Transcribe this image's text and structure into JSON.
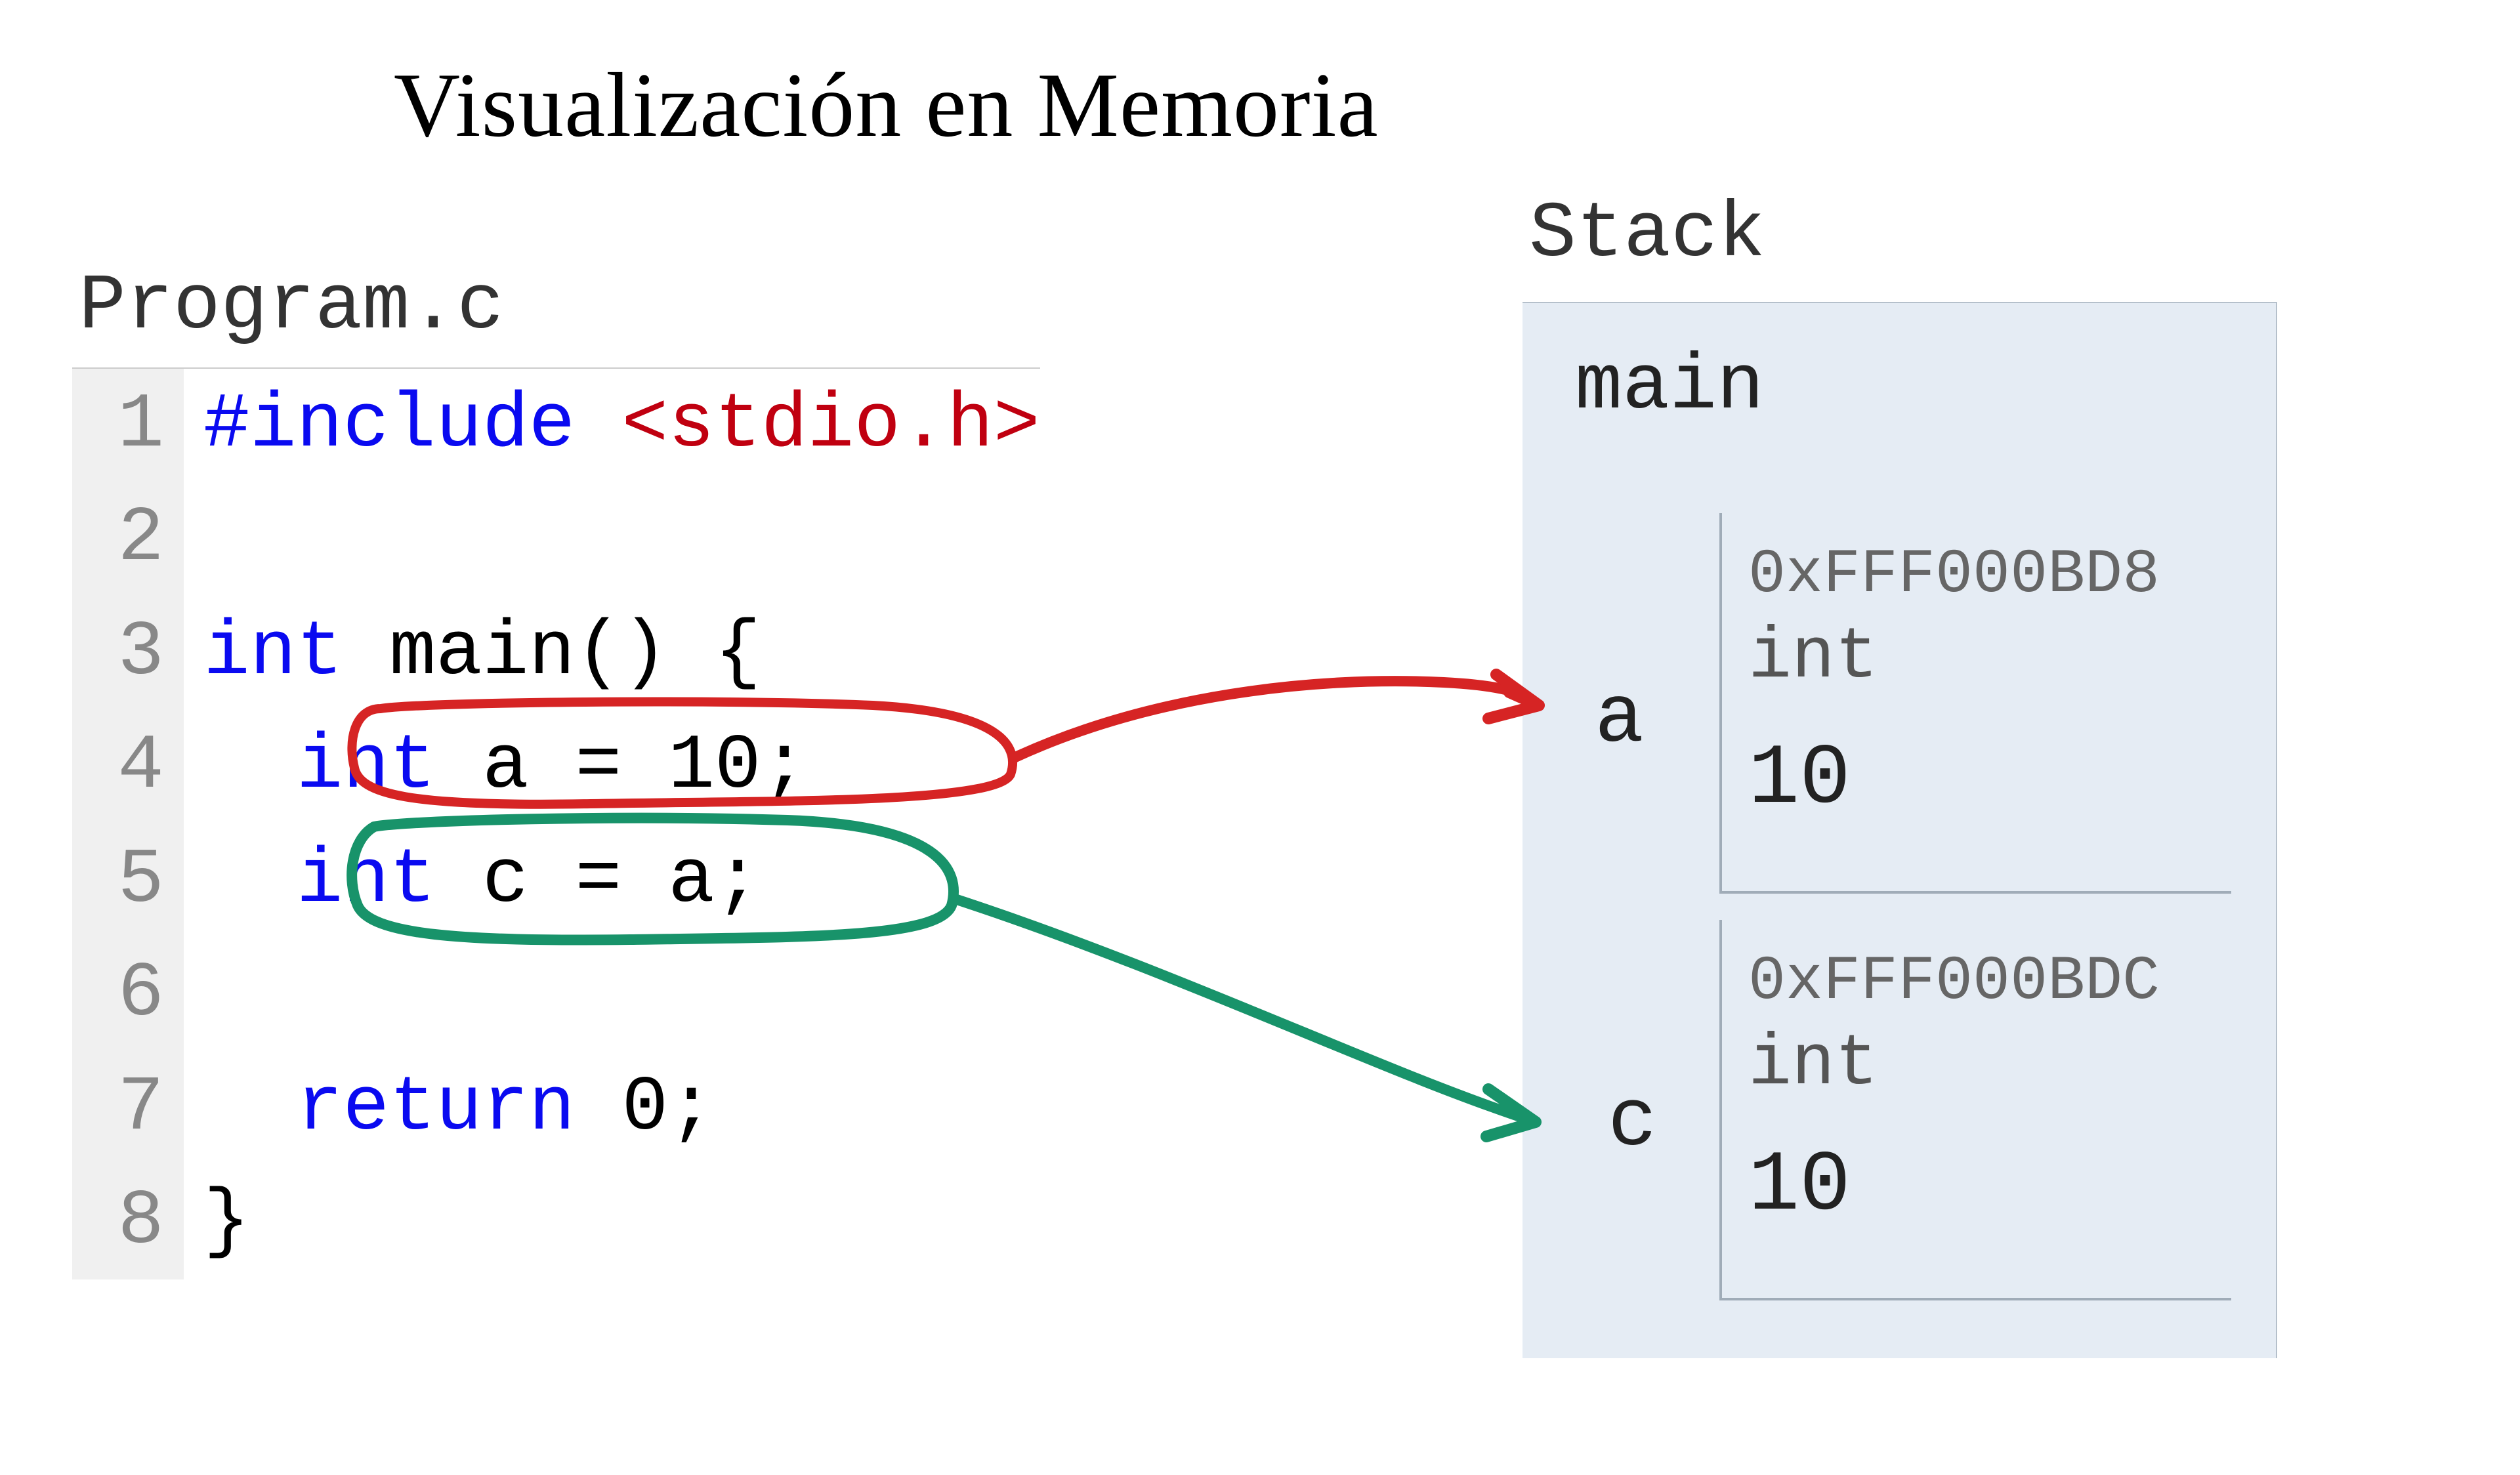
{
  "title": "Visualización en Memoria",
  "file_label": "Program.c",
  "stack_label": "Stack",
  "code": {
    "lines": [
      "1",
      "2",
      "3",
      "4",
      "5",
      "6",
      "7",
      "8"
    ],
    "line1_preproc": "#include",
    "line1_includefile": "<stdio.h>",
    "line3_kw": "int",
    "line3_rest": "main() {",
    "line4_kw": "int",
    "line4_rest": "a = 10;",
    "line5_kw": "int",
    "line5_rest": "c = a;",
    "line7_kw": "return",
    "line7_rest": "0;",
    "line8_rest": "}"
  },
  "stack": {
    "frame": "main",
    "vars": [
      {
        "name": "a",
        "addr": "0xFFF000BD8",
        "type": "int",
        "value": "10"
      },
      {
        "name": "c",
        "addr": "0xFFF000BDC",
        "type": "int",
        "value": "10"
      }
    ]
  },
  "annotations": {
    "circle_a_color": "#d62424",
    "circle_c_color": "#18936a"
  }
}
